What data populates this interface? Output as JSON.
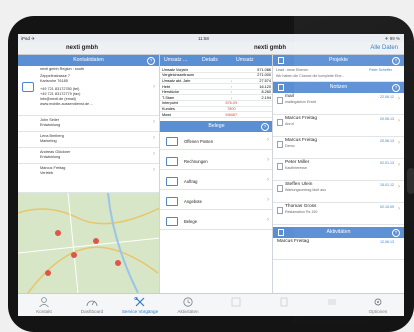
{
  "status": {
    "left": "iPad ✈",
    "time": "11:58",
    "right": "✈ 99 %"
  },
  "nav": {
    "left_title": "nexti gmbh",
    "center_title": "nexti gmbh",
    "right_button": "Alle Daten"
  },
  "contacts": {
    "header": "Kontaktdaten",
    "company_line": "nexti gmbh Region : south",
    "address": [
      "Zeppelinstrasse 7",
      "Karlsruhe 76185"
    ],
    "phones": [
      "+49 721 83172780 (tel)",
      "+49 721 83172779 (fax)",
      "info@nexti.de (email)",
      "www.mobile-aussendienst.de ..."
    ],
    "people": [
      {
        "name": "John Seiler",
        "role": "Entwicklung"
      },
      {
        "name": "Lena Breiberg",
        "role": "Marketing"
      },
      {
        "name": "Andreas Glöckner",
        "role": "Entwicklung"
      },
      {
        "name": "Marcus Freitag",
        "role": "Vertrieb"
      }
    ]
  },
  "stats": {
    "tabs": [
      "Umsatz ...",
      "Details",
      "Umsatz"
    ],
    "rows": [
      [
        "Umsatz Vorjahr",
        "",
        "571.086"
      ],
      [
        "Vergleichszeitraum",
        "",
        "271.000"
      ],
      [
        "Umsatz akt. Jahr",
        "↓",
        "27.574"
      ],
      [
        "Hebt",
        "↑",
        "16.120"
      ],
      [
        "Herstücke",
        "↓",
        "8.260"
      ],
      [
        "T-Stam",
        "↓",
        "2.194"
      ],
      [
        "Interpoint",
        "876-09",
        ""
      ],
      [
        "Kundes",
        "7800",
        ""
      ],
      [
        "Mwst",
        "M6067",
        ""
      ]
    ]
  },
  "belege": {
    "header": "Belege",
    "items": [
      "Offenen Posten",
      "Rechnungen",
      "Auftrag",
      "Angebote",
      "Belege"
    ]
  },
  "projects": {
    "header": "Projekte",
    "line1": "Lead : neue Ebenen",
    "line1_right": "Peter Scheffer",
    "line2": "Wir haben die Chance die komplette Ebe..."
  },
  "notes": {
    "header": "Notizen",
    "items": [
      {
        "title": "mail",
        "sub": "mailingaktion Erkelt",
        "date": "22.06.12"
      },
      {
        "title": "Marcus Freitag",
        "sub": "Anruf",
        "date": "20.06.13"
      },
      {
        "title": "Marcus Freitag",
        "sub": "Demo",
        "date": "20.06.13"
      },
      {
        "title": "Peter Miller",
        "sub": "Kaufinteresse",
        "date": "02.01.13"
      },
      {
        "title": "Steffen Ulein",
        "sub": "Wartungsvertrag läuft aus",
        "date": "15.01.12"
      },
      {
        "title": "Thomas Gross",
        "sub": "Reklamation Rs 190",
        "date": "02.10.09"
      }
    ]
  },
  "activities": {
    "header": "Aktivitäten",
    "first": "Marcus Freitag",
    "first_date": "12.06.13"
  },
  "tabbar": [
    {
      "label": "Kontakt",
      "icon": "person-icon"
    },
    {
      "label": "Dashboard",
      "icon": "gauge-icon"
    },
    {
      "label": "Service Vorgänge",
      "icon": "tools-icon"
    },
    {
      "label": "Aktivitäten",
      "icon": "clock-icon"
    },
    {
      "label": "",
      "icon": "grid-icon"
    },
    {
      "label": "",
      "icon": "doc-icon"
    },
    {
      "label": "",
      "icon": "list-icon"
    },
    {
      "label": "Optionen",
      "icon": "gear-icon"
    }
  ]
}
